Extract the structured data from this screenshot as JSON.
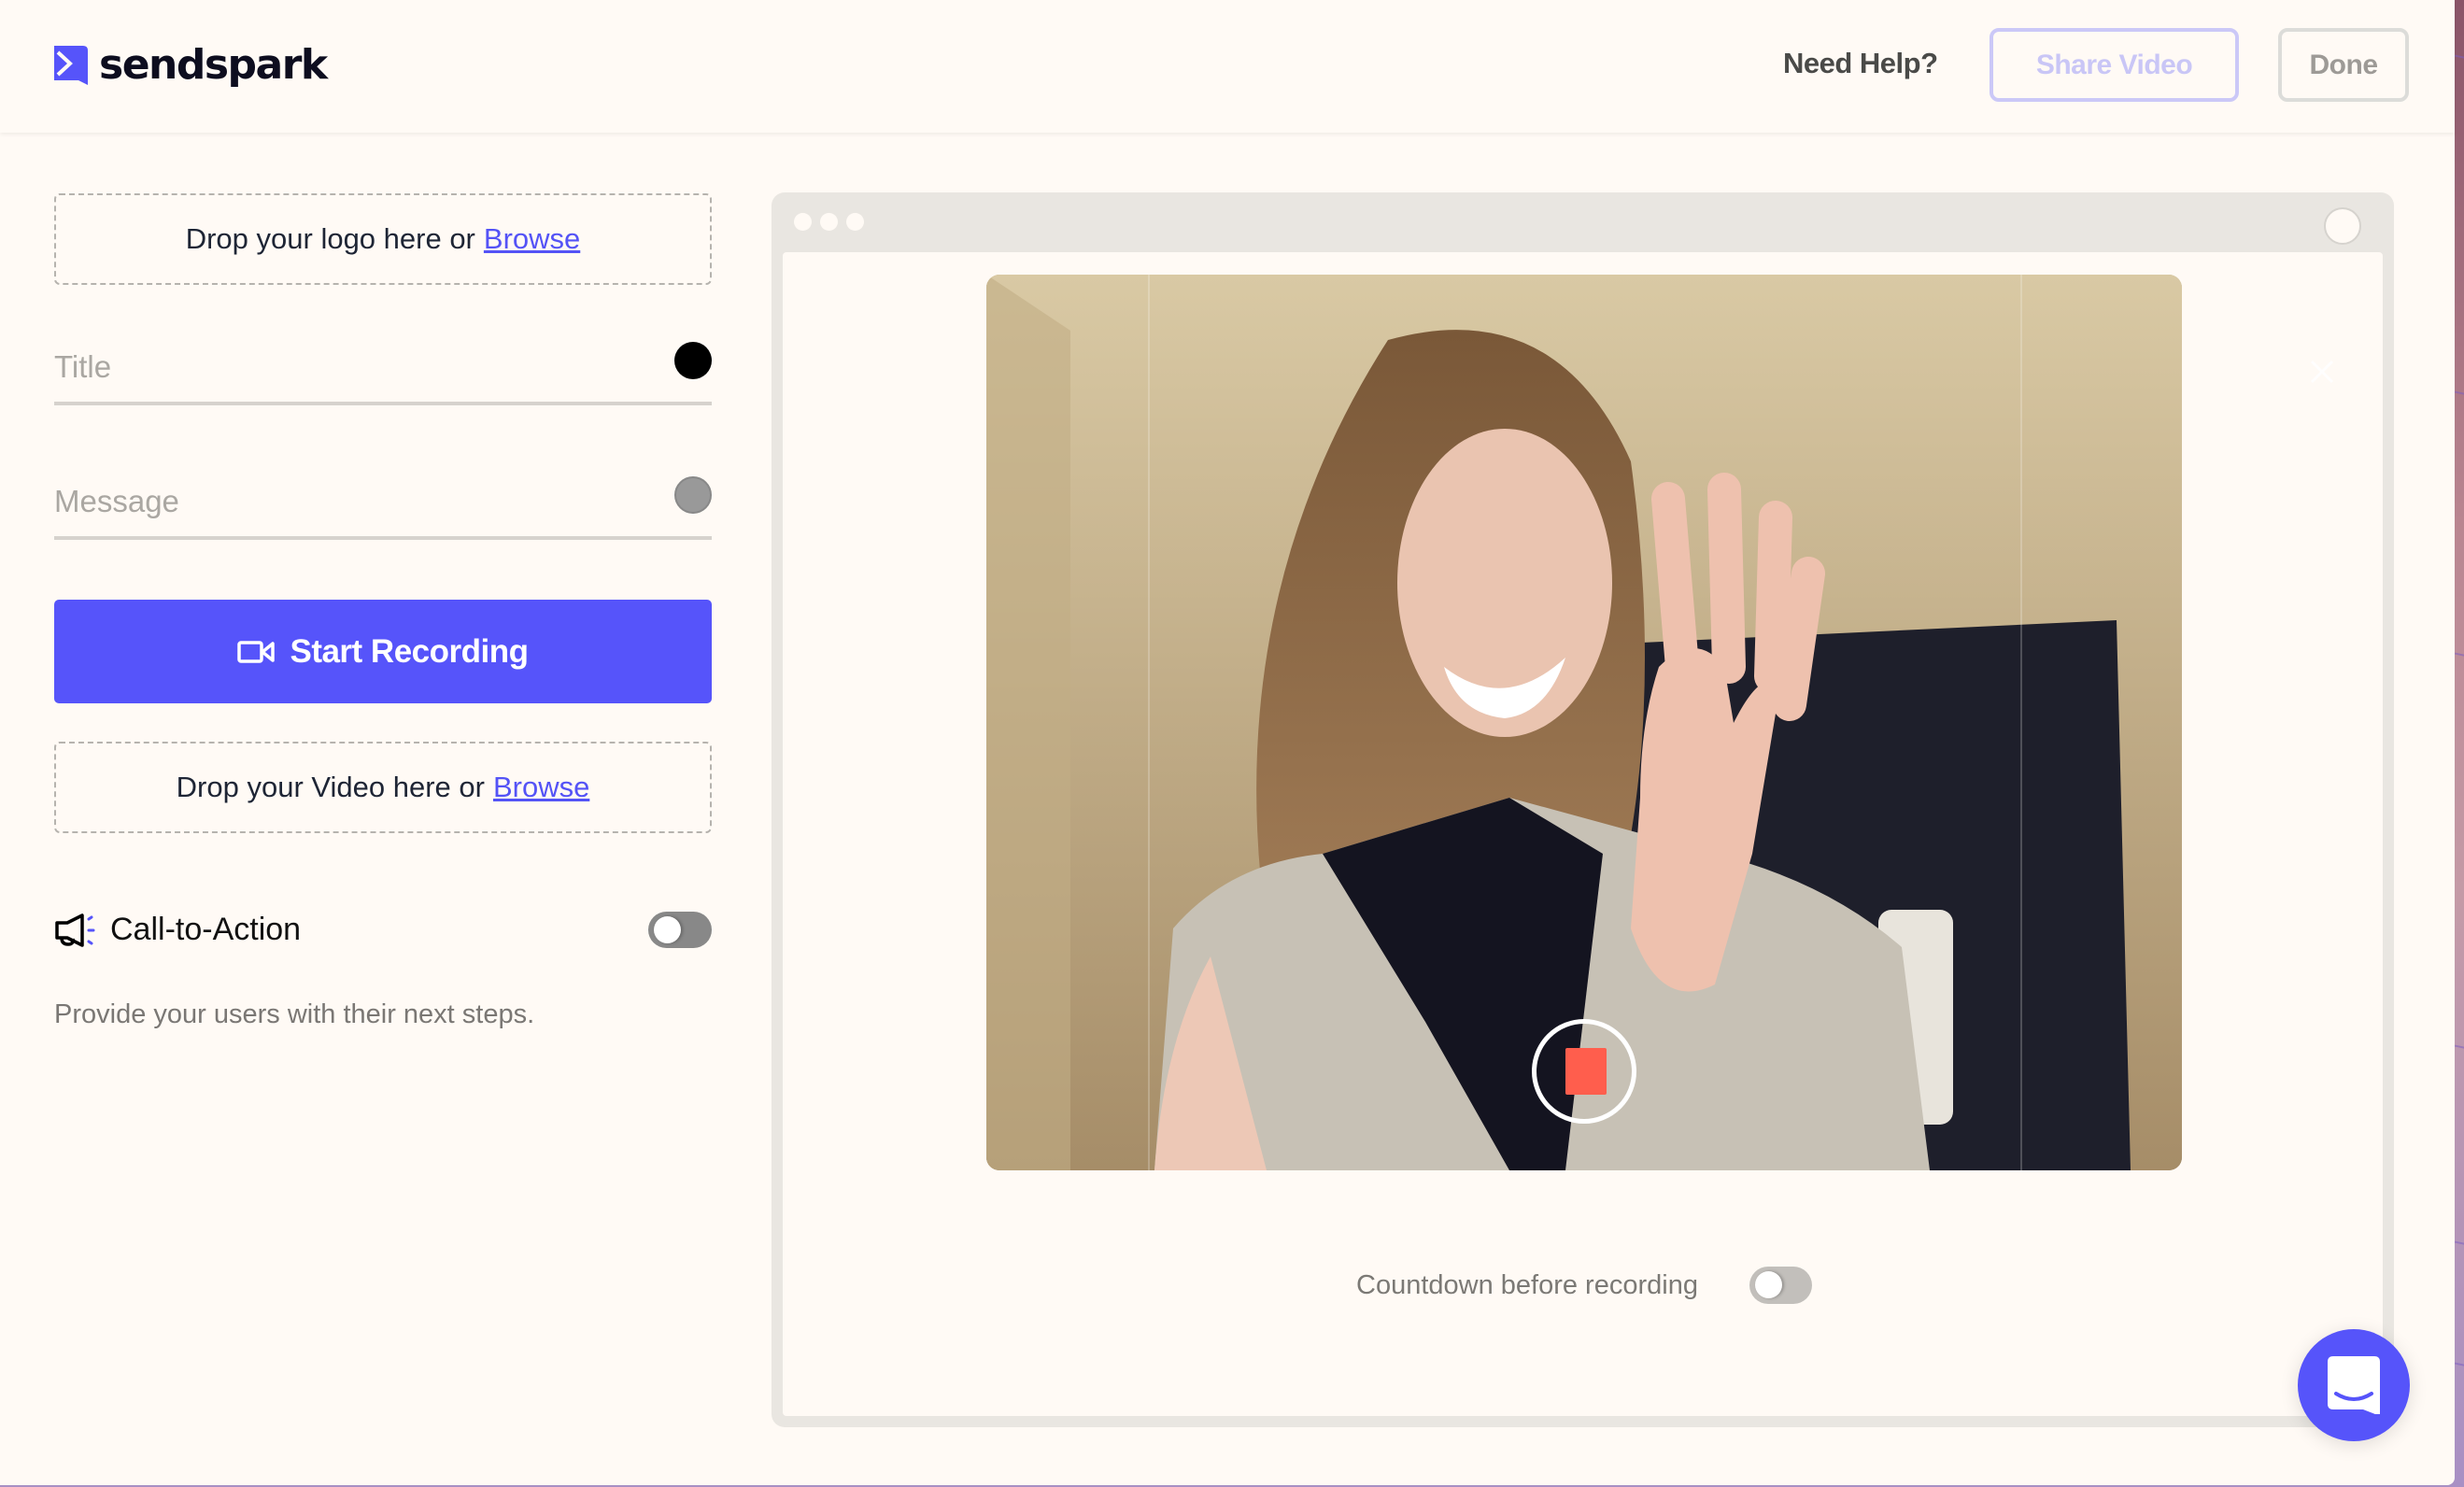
{
  "app": {
    "brand": "sendspark",
    "colors": {
      "accent": "#5654fa",
      "background": "#fffaf5",
      "record": "#ff5e4d"
    }
  },
  "header": {
    "need_help": "Need Help?",
    "share_button": "Share Video",
    "done_button": "Done"
  },
  "sidebar": {
    "logo_drop": {
      "text": "Drop your logo here or",
      "link": "Browse"
    },
    "title_field": {
      "placeholder": "Title",
      "color": "#000000"
    },
    "message_field": {
      "placeholder": "Message",
      "color": "#999999"
    },
    "start_recording": "Start Recording",
    "video_drop": {
      "text": "Drop your Video here or",
      "link": "Browse"
    },
    "cta": {
      "label": "Call-to-Action",
      "enabled": false,
      "description": "Provide your users with their next steps."
    }
  },
  "preview": {
    "recording": true,
    "countdown": {
      "label": "Countdown before recording",
      "enabled": false
    }
  },
  "icons": {
    "logo": "sendspark-logo-icon",
    "camera": "video-camera-icon",
    "megaphone": "megaphone-icon",
    "stop": "stop-icon",
    "close": "close-icon",
    "chat": "chat-icon"
  }
}
